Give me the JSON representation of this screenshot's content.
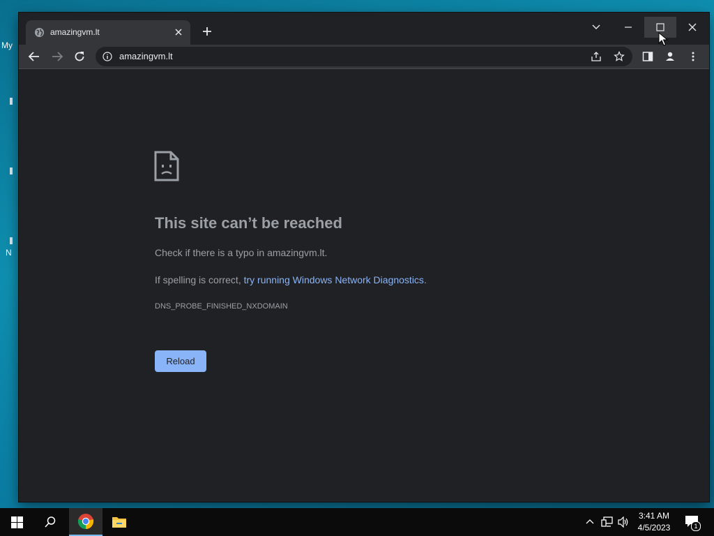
{
  "desktop": {
    "fragment_my": "My",
    "fragment_n": "N"
  },
  "tab": {
    "title": "amazingvm.lt",
    "favicon": "globe-icon"
  },
  "toolbar": {
    "url": "amazingvm.lt"
  },
  "error": {
    "headline": "This site can’t be reached",
    "line1": "Check if there is a typo in amazingvm.lt.",
    "line2_prefix": "If spelling is correct, ",
    "line2_link": "try running Windows Network Diagnostics",
    "line2_suffix": ".",
    "code": "DNS_PROBE_FINISHED_NXDOMAIN",
    "reload_label": "Reload"
  },
  "taskbar": {
    "time": "3:41 AM",
    "date": "4/5/2023",
    "notification_count": "1"
  },
  "colors": {
    "link": "#8ab4f8",
    "button": "#8ab4f8",
    "background": "#202124"
  }
}
